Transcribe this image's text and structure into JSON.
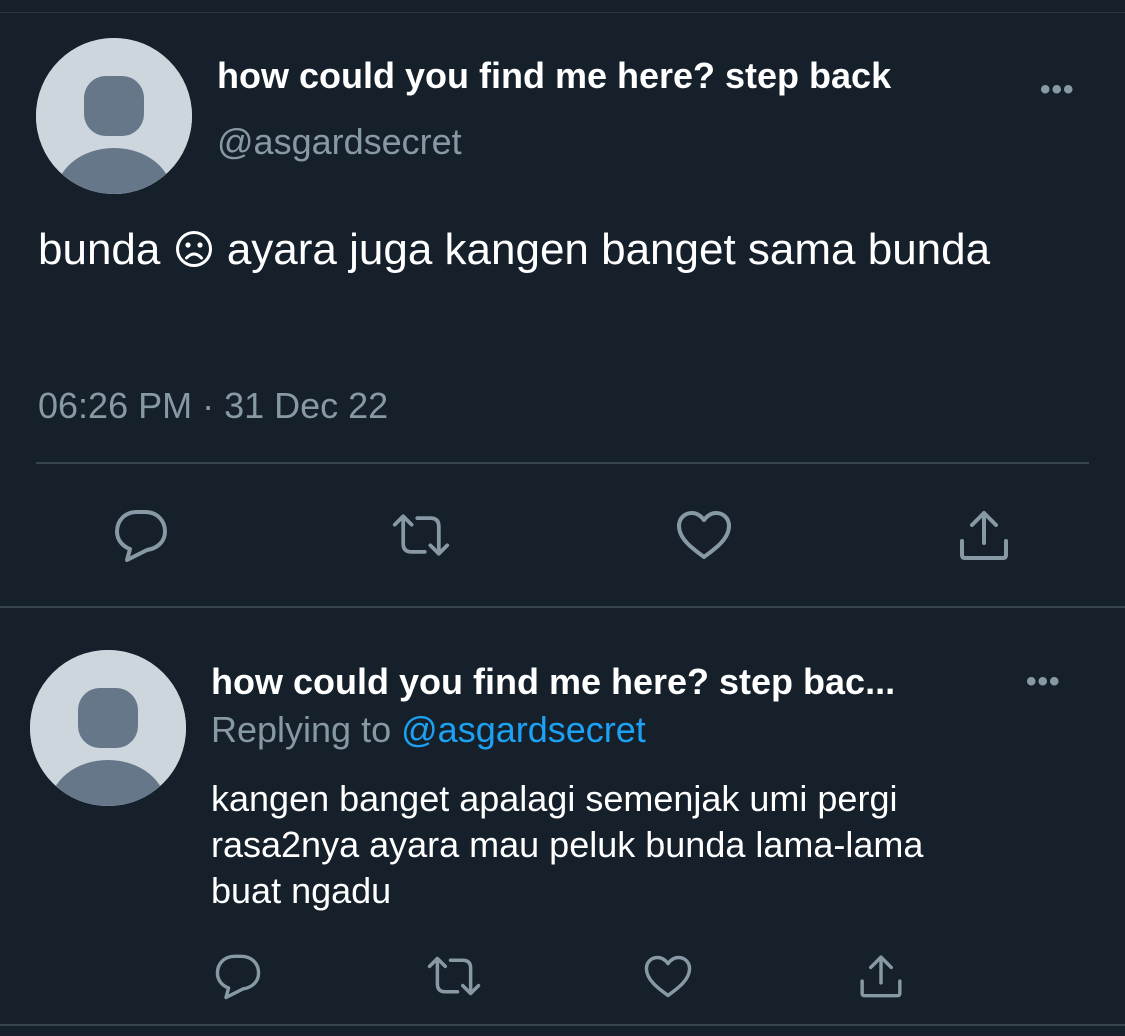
{
  "main_tweet": {
    "display_name": "how could you find me here? step back",
    "handle": "@asgardsecret",
    "more_label": "•••",
    "text_before_emoji": "bunda",
    "emoji": "frowning-face",
    "text_after_emoji": "ayara juga kangen banget sama bunda",
    "timestamp": "06:26 PM · 31 Dec 22"
  },
  "reply_tweet": {
    "display_name": "how could you find me here? step bac...",
    "more_label": "•••",
    "replying_prefix": "Replying to",
    "replying_handle": "@asgardsecret",
    "text_lines": [
      "kangen banget apalagi semenjak umi pergi",
      "rasa2nya ayara mau peluk bunda lama-lama",
      "buat ngadu"
    ]
  },
  "actions": [
    "reply-icon",
    "retweet-icon",
    "like-icon",
    "share-icon"
  ],
  "colors": {
    "background": "#15202b",
    "text": "#ffffff",
    "secondary_text": "#8899a6",
    "link": "#1da1f2",
    "divider": "#38444d",
    "avatar_bg": "#ced6dd",
    "avatar_fg": "#66778a"
  }
}
